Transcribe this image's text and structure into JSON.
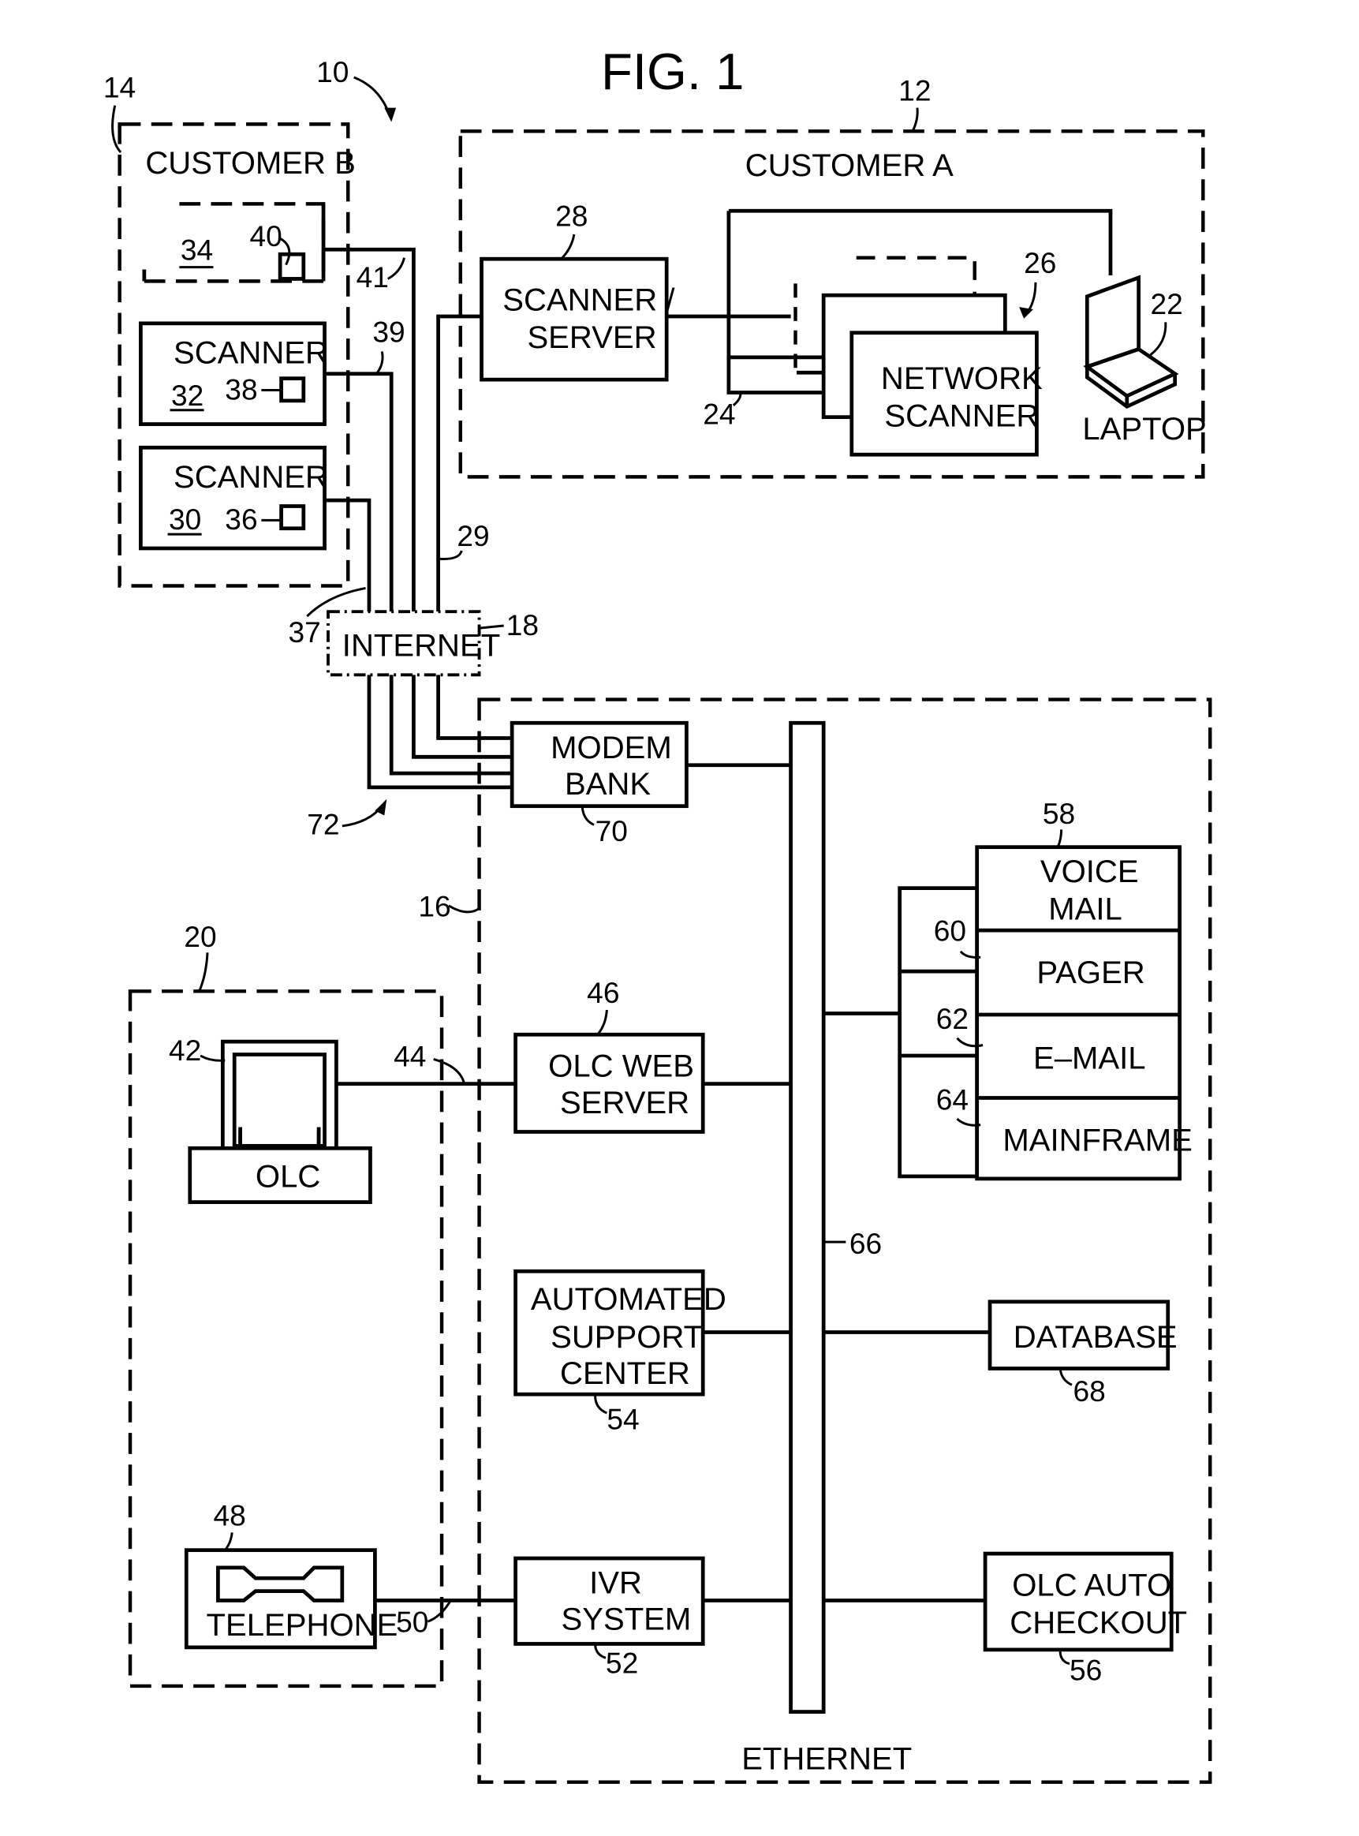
{
  "figure": {
    "title": "FIG. 1",
    "system_ref": "10"
  },
  "customer_a": {
    "label": "CUSTOMER  A",
    "ref": "12",
    "scanner_server": {
      "line1": "SCANNER /",
      "line2": "SERVER",
      "ref": "28"
    },
    "network_scanner": {
      "line1": "NETWORK",
      "line2": "SCANNER",
      "ref": "26"
    },
    "network_ref": "24",
    "laptop": {
      "label": "LAPTOP",
      "ref": "22"
    }
  },
  "customer_b": {
    "label": "CUSTOMER  B",
    "ref": "14",
    "device_34": {
      "ref": "34",
      "port_ref": "40",
      "line_ref": "41"
    },
    "scanner_32": {
      "label": "SCANNER",
      "ref": "32",
      "port_ref": "38",
      "line_ref": "39"
    },
    "scanner_30": {
      "label": "SCANNER",
      "ref": "30",
      "port_ref": "36",
      "line_ref": "37"
    }
  },
  "links": {
    "customer_a_line_ref": "29",
    "bundle_ref": "72"
  },
  "internet": {
    "label": "INTERNET",
    "ref": "18"
  },
  "service_center": {
    "ref": "16",
    "ethernet_label": "ETHERNET",
    "ethernet_ref": "66",
    "modem_bank": {
      "line1": "MODEM",
      "line2": "BANK",
      "ref": "70"
    },
    "olc_web_server": {
      "line1": "OLC  WEB",
      "line2": "SERVER",
      "ref": "46"
    },
    "automated_support": {
      "line1": "AUTOMATED",
      "line2": "SUPPORT",
      "line3": "CENTER",
      "ref": "54"
    },
    "ivr_system": {
      "line1": "IVR",
      "line2": "SYSTEM",
      "ref": "52"
    },
    "notification_stack": {
      "ref": "58",
      "items": [
        {
          "line1": "VOICE",
          "line2": "MAIL"
        },
        {
          "line1": "PAGER",
          "ref": "60"
        },
        {
          "line1": "E–MAIL",
          "ref": "62"
        },
        {
          "line1": "MAINFRAME",
          "ref": "64"
        }
      ]
    },
    "database": {
      "label": "DATABASE",
      "ref": "68"
    },
    "olc_auto_checkout": {
      "line1": "OLC  AUTO",
      "line2": "CHECKOUT",
      "ref": "56"
    }
  },
  "olc_station": {
    "ref": "20",
    "computer": {
      "label": "OLC",
      "ref": "42",
      "line_ref": "44"
    },
    "telephone": {
      "label": "TELEPHONE",
      "ref": "48",
      "line_ref": "50"
    }
  }
}
